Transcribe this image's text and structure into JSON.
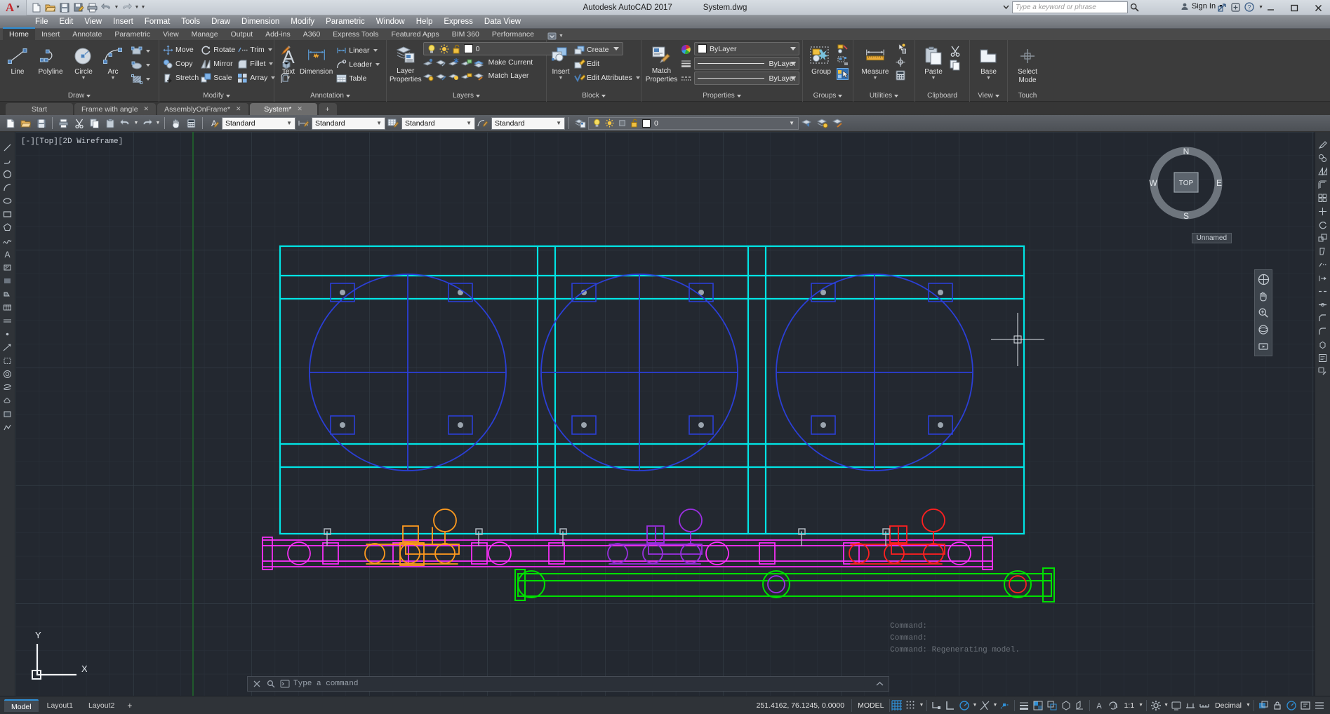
{
  "titlebar": {
    "app_title": "Autodesk AutoCAD 2017",
    "document_title": "System.dwg",
    "search_placeholder": "Type a keyword or phrase",
    "sign_in": "Sign In",
    "quick_access": [
      {
        "name": "new-icon",
        "label": "New"
      },
      {
        "name": "open-icon",
        "label": "Open"
      },
      {
        "name": "save-icon",
        "label": "Save"
      },
      {
        "name": "save-as-icon",
        "label": "Save As"
      },
      {
        "name": "plot-icon",
        "label": "Plot"
      },
      {
        "name": "undo-icon",
        "label": "Undo"
      },
      {
        "name": "redo-icon",
        "label": "Redo"
      },
      {
        "name": "qat-more-icon",
        "label": "Customize"
      }
    ],
    "window_controls": [
      "minimize",
      "maximize",
      "close"
    ]
  },
  "menubar": [
    "File",
    "Edit",
    "View",
    "Insert",
    "Format",
    "Tools",
    "Draw",
    "Dimension",
    "Modify",
    "Parametric",
    "Window",
    "Help",
    "Express",
    "Data View"
  ],
  "ribbon_tabs": [
    {
      "label": "Home",
      "active": true
    },
    {
      "label": "Insert",
      "active": false
    },
    {
      "label": "Annotate",
      "active": false
    },
    {
      "label": "Parametric",
      "active": false
    },
    {
      "label": "View",
      "active": false
    },
    {
      "label": "Manage",
      "active": false
    },
    {
      "label": "Output",
      "active": false
    },
    {
      "label": "Add-ins",
      "active": false
    },
    {
      "label": "A360",
      "active": false
    },
    {
      "label": "Express Tools",
      "active": false
    },
    {
      "label": "Featured Apps",
      "active": false
    },
    {
      "label": "BIM 360",
      "active": false
    },
    {
      "label": "Performance",
      "active": false
    }
  ],
  "ribbon": {
    "draw": {
      "title": "Draw",
      "big": [
        {
          "label": "Line",
          "icon": "line-icon"
        },
        {
          "label": "Polyline",
          "icon": "polyline-icon"
        },
        {
          "label": "Circle",
          "icon": "circle-icon",
          "has_dropdown": true
        },
        {
          "label": "Arc",
          "icon": "arc-icon",
          "has_dropdown": true
        }
      ],
      "small": [
        {
          "label": "",
          "icon": "rectangle-icon",
          "has_dropdown": true
        },
        {
          "label": "",
          "icon": "ellipse-icon",
          "has_dropdown": true
        },
        {
          "label": "",
          "icon": "hatch-icon",
          "has_dropdown": true
        }
      ]
    },
    "modify": {
      "title": "Modify",
      "items": [
        {
          "label": "Move",
          "icon": "move-icon"
        },
        {
          "label": "Copy",
          "icon": "copy-icon"
        },
        {
          "label": "Stretch",
          "icon": "stretch-icon"
        },
        {
          "label": "Rotate",
          "icon": "rotate-icon"
        },
        {
          "label": "Mirror",
          "icon": "mirror-icon"
        },
        {
          "label": "Scale",
          "icon": "scale-icon"
        },
        {
          "label": "Trim",
          "icon": "trim-icon",
          "has_dropdown": true
        },
        {
          "label": "Fillet",
          "icon": "fillet-icon",
          "has_dropdown": true
        },
        {
          "label": "Array",
          "icon": "array-icon",
          "has_dropdown": true
        }
      ],
      "extra": [
        {
          "icon": "erase-icon"
        },
        {
          "icon": "explode-icon"
        },
        {
          "icon": "offset-icon"
        }
      ]
    },
    "annotation": {
      "title": "Annotation",
      "big": [
        {
          "label": "Text",
          "icon": "text-icon",
          "has_dropdown": true
        },
        {
          "label": "Dimension",
          "icon": "dimension-icon"
        }
      ],
      "small": [
        {
          "label": "Linear",
          "icon": "linear-dim-icon",
          "has_dropdown": true
        },
        {
          "label": "Leader",
          "icon": "leader-icon",
          "has_dropdown": true
        },
        {
          "label": "Table",
          "icon": "table-icon"
        }
      ]
    },
    "layers": {
      "title": "Layers",
      "big": [
        {
          "label": "Layer\nProperties",
          "label1": "Layer",
          "label2": "Properties",
          "icon": "layer-properties-icon"
        }
      ],
      "current_layer": "0",
      "layer_state_icons": [
        "lightbulb-icon",
        "sun-icon",
        "unlock-icon"
      ],
      "small": [
        {
          "label": "Make Current",
          "icon": "make-current-icon"
        },
        {
          "label": "Match Layer",
          "icon": "match-layer-icon"
        }
      ],
      "tool_icons_row1": [
        "layer-isolate-icon",
        "layer-unisolate-icon",
        "layer-freeze-icon",
        "layer-lock-icon"
      ],
      "tool_icons_row2": [
        "layer-off-icon",
        "layer-change-icon",
        "layer-on-icon",
        "layer-unlock-icon"
      ]
    },
    "block": {
      "title": "Block",
      "big": [
        {
          "label": "Insert",
          "icon": "insert-block-icon",
          "has_dropdown": true
        }
      ],
      "small": [
        {
          "label": "Create",
          "icon": "create-block-icon"
        },
        {
          "label": "Edit",
          "icon": "edit-block-icon"
        },
        {
          "label": "Edit Attributes",
          "icon": "edit-attributes-icon",
          "has_dropdown": true
        }
      ]
    },
    "properties": {
      "title": "Properties",
      "big": [
        {
          "label1": "Match",
          "label2": "Properties",
          "icon": "match-properties-icon"
        }
      ],
      "combos": [
        {
          "name": "color-combo",
          "value": "ByLayer",
          "icon": "color-wheel-icon"
        },
        {
          "name": "linewidth-combo",
          "value": "ByLayer",
          "icon": "linewidth-icon"
        },
        {
          "name": "linetype-combo",
          "value": "ByLayer",
          "icon": "linetype-icon"
        }
      ]
    },
    "groups": {
      "title": "Groups",
      "big": [
        {
          "label": "Group",
          "icon": "group-icon"
        }
      ],
      "small": [
        {
          "icon": "ungroup-icon"
        },
        {
          "icon": "group-edit-icon"
        },
        {
          "icon": "group-selection-on-icon"
        }
      ]
    },
    "utilities": {
      "title": "Utilities",
      "big": [
        {
          "label": "Measure",
          "icon": "measure-icon",
          "has_dropdown": true
        }
      ],
      "small": [
        {
          "icon": "quick-select-icon"
        },
        {
          "icon": "point-id-icon"
        },
        {
          "icon": "calculator-icon"
        }
      ]
    },
    "clipboard": {
      "title": "Clipboard",
      "big": [
        {
          "label": "Paste",
          "icon": "paste-icon",
          "has_dropdown": true
        }
      ],
      "small": [
        {
          "icon": "cut-icon"
        },
        {
          "icon": "copy-clip-icon"
        }
      ]
    },
    "view": {
      "title": "View",
      "big": [
        {
          "label": "Base",
          "icon": "base-view-icon",
          "has_dropdown": true
        }
      ]
    },
    "touch": {
      "title": "Touch",
      "big": [
        {
          "label1": "Select",
          "label2": "Mode",
          "icon": "select-mode-icon"
        }
      ]
    }
  },
  "file_tabs": [
    {
      "label": "Start",
      "closable": false,
      "active": false
    },
    {
      "label": "Frame with angle",
      "closable": true,
      "active": false
    },
    {
      "label": "AssemblyOnFrame*",
      "closable": true,
      "active": false
    },
    {
      "label": "System*",
      "closable": true,
      "active": true
    },
    {
      "label": "+",
      "closable": false,
      "active": false,
      "is_add": true
    }
  ],
  "toolbar": {
    "buttons": [
      {
        "name": "new-icon"
      },
      {
        "name": "open-icon"
      },
      {
        "name": "save-icon"
      },
      {
        "name": "plot-icon"
      },
      {
        "name": "cut-icon"
      },
      {
        "name": "copy-icon"
      },
      {
        "name": "paste-icon"
      },
      {
        "name": "undo-icon"
      },
      {
        "name": "redo-icon"
      },
      {
        "name": "pan-icon"
      },
      {
        "name": "calculator-icon"
      }
    ],
    "style_combos": [
      {
        "name": "text-style-combo",
        "value": "Standard",
        "icon": "text-style-icon"
      },
      {
        "name": "dim-style-combo",
        "value": "Standard",
        "icon": "dim-style-icon"
      },
      {
        "name": "table-style-combo",
        "value": "Standard",
        "icon": "table-style-icon"
      },
      {
        "name": "mleader-style-combo",
        "value": "Standard",
        "icon": "mleader-style-icon"
      }
    ],
    "layer_value": "0",
    "layer_icons": [
      "lightbulb-icon",
      "sun-icon",
      "freeze-icon",
      "unlock-icon",
      "color-swatch"
    ],
    "right_icons": [
      "layer-props-icon",
      "layer-prev-icon",
      "layer-state-icon"
    ]
  },
  "canvas": {
    "viewport_label": "[-][Top][2D Wireframe]",
    "viewcube": {
      "north": "N",
      "south": "S",
      "east": "E",
      "west": "W",
      "top": "TOP"
    },
    "ucs_label": "Unnamed",
    "axis_y": "Y",
    "axis_x": "X",
    "command_history": [
      "Command:",
      "Command:",
      "Command: Regenerating model."
    ],
    "command_placeholder": "Type a command"
  },
  "statusbar": {
    "layout_tabs": [
      {
        "label": "Model",
        "active": true
      },
      {
        "label": "Layout1",
        "active": false
      },
      {
        "label": "Layout2",
        "active": false
      }
    ],
    "add_layout": "+",
    "coordinates": "251.4162, 76.1245, 0.0000",
    "space": "MODEL",
    "scale": "1:1",
    "units": "Decimal",
    "icons": [
      {
        "name": "grid-icon"
      },
      {
        "name": "snap-icon"
      },
      {
        "name": "infer-constraints-icon"
      },
      {
        "name": "ortho-icon"
      },
      {
        "name": "polar-tracking-icon"
      },
      {
        "name": "osnap-icon"
      },
      {
        "name": "object-snap-tracking-icon"
      },
      {
        "name": "lineweight-icon"
      },
      {
        "name": "transparency-icon"
      },
      {
        "name": "selection-cycling-icon"
      },
      {
        "name": "3d-osnap-icon"
      },
      {
        "name": "dynamic-ucs-icon"
      },
      {
        "name": "annotation-visibility-icon"
      },
      {
        "name": "workspace-icon"
      },
      {
        "name": "annotation-monitor-icon"
      },
      {
        "name": "isolate-objects-icon"
      },
      {
        "name": "hardware-accel-icon"
      },
      {
        "name": "clean-screen-icon"
      },
      {
        "name": "customization-icon"
      }
    ]
  },
  "colors": {
    "accent": "#2f8fd6",
    "canvas_bg": "#232830",
    "cyan": "#00e5e5",
    "blue": "#2b3fd6",
    "magenta": "#ff2fff",
    "green": "#00e000",
    "orange": "#ff9a1e",
    "purple": "#9a2fe0",
    "red": "#ff2020",
    "grid": "#323a44"
  }
}
